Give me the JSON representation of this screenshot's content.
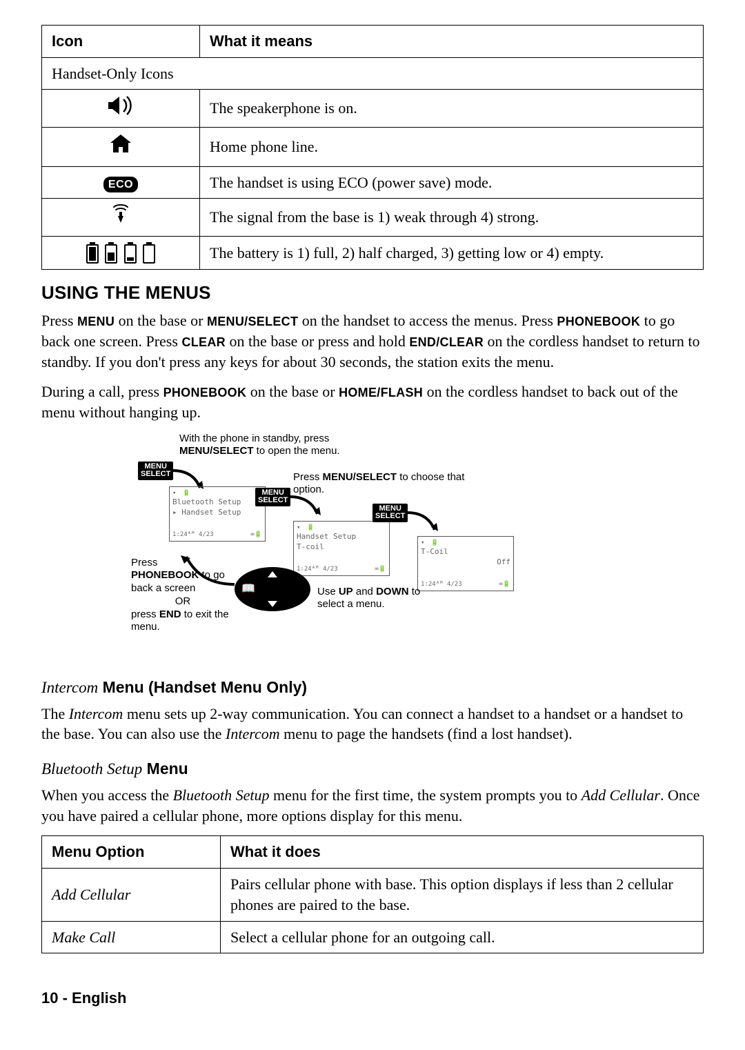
{
  "icon_table": {
    "headers": {
      "icon": "Icon",
      "meaning": "What it means"
    },
    "group_row": "Handset-Only Icons",
    "rows": [
      {
        "icon_name": "speakerphone-icon",
        "meaning": "The speakerphone is on."
      },
      {
        "icon_name": "home-icon",
        "meaning": "Home phone line."
      },
      {
        "icon_name": "eco-icon",
        "eco_label": "ECO",
        "meaning": "The handset is using ECO (power save) mode."
      },
      {
        "icon_name": "signal-icon",
        "meaning": "The signal from the base is 1) weak through 4) strong."
      },
      {
        "icon_name": "battery-icon",
        "meaning": "The battery is 1) full, 2) half charged, 3) getting low or 4) empty."
      }
    ]
  },
  "section_using_menus": {
    "title": "Using the Menus",
    "para1_parts": {
      "a": "Press ",
      "k1": "Menu",
      "b": " on the base or ",
      "k2": "Menu/Select",
      "c": " on the handset to access the menus. Press ",
      "k3": "Phonebook",
      "d": " to go back one screen. Press ",
      "k4": "Clear",
      "e": " on the base or press and hold ",
      "k5": "End/Clear",
      "f": " on the cordless handset to return to standby. If you don't press any keys for about 30 seconds, the station exits the menu."
    },
    "para2_parts": {
      "a": "During a call, press ",
      "k1": "Phonebook",
      "b": " on the base or ",
      "k2": "Home/Flash",
      "c": " on the cordless handset to back out of the menu without hanging up."
    }
  },
  "diagram": {
    "top_caption_a": "With the phone in standby, press",
    "top_caption_b": " to open the menu.",
    "top_caption_key": "MENU/SELECT",
    "choose_caption_a": "Press ",
    "choose_caption_key": "MENU/SELECT",
    "choose_caption_b": " to choose that option.",
    "back_caption_a": "Press",
    "back_caption_key": "PHONEBOOK",
    "back_caption_b": " to go back a screen",
    "back_caption_c": "OR",
    "back_caption_d_a": "press ",
    "back_caption_d_key": "END",
    "back_caption_d_b": " to exit the menu.",
    "updown_a": "Use ",
    "updown_k1": "UP",
    "updown_b": " and ",
    "updown_k2": "DOWN",
    "updown_c": " to select a menu.",
    "menu_button_label": "MENU\nSELECT",
    "lcd1": {
      "line1": "Bluetooth Setup",
      "line2": "▸ Handset Setup",
      "time": "1:24",
      "date": "4/23"
    },
    "lcd2": {
      "line1": "Handset Setup",
      "line2": "T-coil",
      "time": "1:24",
      "date": "4/23"
    },
    "lcd3": {
      "line1": "T-Coil",
      "line2": "Off",
      "time": "1:24",
      "date": "4/23"
    }
  },
  "intercom": {
    "title_ital": "Intercom",
    "title_bold": " Menu (Handset Menu Only)",
    "para_parts": {
      "a": "The ",
      "i1": "Intercom",
      "b": " menu sets up 2-way communication. You can connect a handset to a handset or a handset to the base. You can also use the ",
      "i2": "Intercom",
      "c": " menu to page the handsets (find a lost handset)."
    }
  },
  "bluetooth": {
    "title_ital": "Bluetooth Setup",
    "title_bold": " Menu",
    "para_parts": {
      "a": "When you access the ",
      "i1": "Bluetooth Setup",
      "b": " menu for the first time, the system prompts you to ",
      "i2": "Add Cellular",
      "c": ". Once you have paired a cellular phone, more options display for  this menu."
    }
  },
  "menu_table": {
    "headers": {
      "option": "Menu Option",
      "does": "What it does"
    },
    "rows": [
      {
        "option": "Add Cellular",
        "does": "Pairs cellular phone with base. This option displays if less than 2 cellular phones are paired to the base."
      },
      {
        "option": "Make Call",
        "does": "Select a cellular phone for an outgoing call."
      }
    ]
  },
  "footer": "10 - English"
}
